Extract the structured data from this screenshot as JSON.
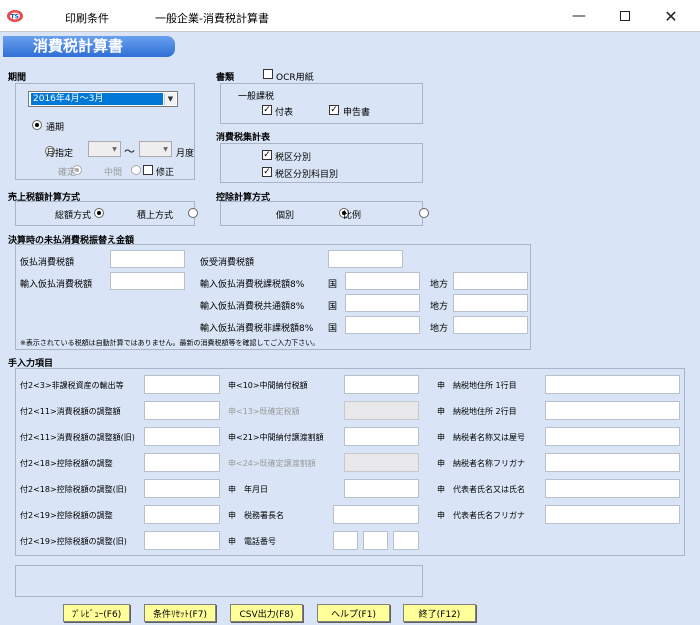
{
  "window": {
    "title": "印刷条件",
    "subtitle": "一般企業-消費税計算書",
    "min_icon": "minimize-icon",
    "max_icon": "maximize-icon",
    "close_icon": "close-icon"
  },
  "banner": "消費税計算書",
  "period": {
    "label": "期間",
    "selected": "2016年4月～3月",
    "option_normal": "通期",
    "option_month": "月指定",
    "tilde": "～",
    "month_unit": "月度",
    "confirmed": "確定",
    "interim": "中間",
    "correction": "修正"
  },
  "docs": {
    "label": "書類",
    "ocr": "OCR用紙",
    "general": "一般課税",
    "attachment": "付表",
    "return": "申告書"
  },
  "summary": {
    "label": "消費税集計表",
    "by_rate": "税区分別",
    "by_rate_account": "税区分別科目別"
  },
  "sales_calc": {
    "label": "売上税額計算方式",
    "total": "総額方式",
    "accumulate": "積上方式"
  },
  "deduction_calc": {
    "label": "控除計算方式",
    "individual": "個別",
    "proportional": "比例"
  },
  "unpaid": {
    "label": "決算時の未払消費税振替え金額",
    "provisional_paid": "仮払消費税額",
    "provisional_received": "仮受消費税額",
    "import_paid": "輸入仮払消費税額",
    "import_taxable": "輸入仮払消費税課税額8%",
    "import_common": "輸入仮払消費税共通額8%",
    "import_nontaxable": "輸入仮払消費税非課税額8%",
    "national": "国",
    "local": "地方",
    "note": "※表示されている税額は自動計算ではありません。最新の消費税額等を確認してご入力下さい。"
  },
  "manual": {
    "label": "手入力項目",
    "col1": [
      "付2<3>非課税資産の輸出等",
      "付2<11>消費税額の調整額",
      "付2<11>消費税額の調整額(旧)",
      "付2<18>控除税額の調整",
      "付2<18>控除税額の調整(旧)",
      "付2<19>控除税額の調整",
      "付2<19>控除税額の調整(旧)"
    ],
    "col2": [
      "申<10>中間納付税額",
      "申<13>既確定税額",
      "申<21>中間納付譲渡割額",
      "申<24>既確定譲渡割額",
      "申　年月日",
      "申　税務署長名",
      "申　電話番号"
    ],
    "col3": [
      "申　納税地住所 1行目",
      "申　納税地住所 2行目",
      "申　納税者名称又は屋号",
      "申　納税者名称フリガナ",
      "申　代表者氏名又は氏名",
      "申　代表者氏名フリガナ"
    ]
  },
  "buttons": {
    "preview": "ﾌﾟﾚﾋﾞｭｰ(F6)",
    "reset": "条件ﾘｾｯﾄ(F7)",
    "csv": "CSV出力(F8)",
    "help": "ヘルプ(F1)",
    "exit": "終了(F12)"
  }
}
